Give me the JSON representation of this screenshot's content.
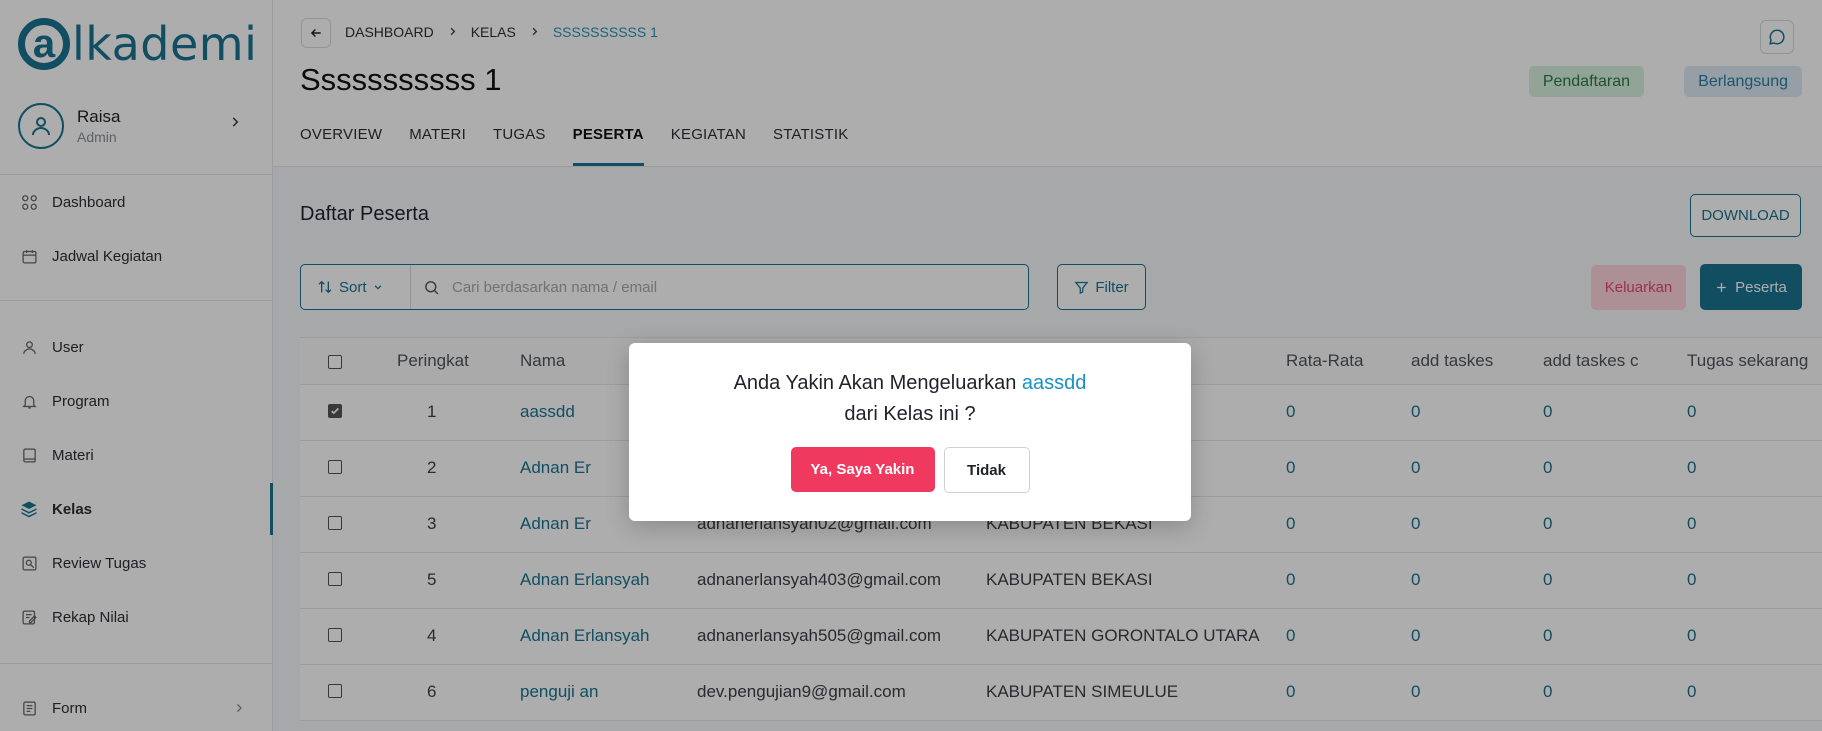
{
  "app": {
    "logo_text": "lkademi",
    "logo_mark": "a"
  },
  "profile": {
    "name": "Raisa",
    "role": "Admin"
  },
  "sidebar": {
    "items": [
      {
        "label": "Dashboard",
        "icon": "grid-icon"
      },
      {
        "label": "Jadwal Kegiatan",
        "icon": "calendar-icon"
      },
      {
        "label": "User",
        "icon": "user-icon"
      },
      {
        "label": "Program",
        "icon": "bell-icon"
      },
      {
        "label": "Materi",
        "icon": "book-icon"
      },
      {
        "label": "Kelas",
        "icon": "layers-icon"
      },
      {
        "label": "Review Tugas",
        "icon": "review-icon"
      },
      {
        "label": "Rekap Nilai",
        "icon": "edit-icon"
      },
      {
        "label": "Form",
        "icon": "form-icon"
      }
    ]
  },
  "breadcrumb": {
    "items": [
      "DASHBOARD",
      "KELAS",
      "SSSSSSSSSS 1"
    ]
  },
  "page": {
    "title": "Sssssssssss 1"
  },
  "badges": {
    "pendaftaran": "Pendaftaran",
    "berlangsung": "Berlangsung"
  },
  "tabs": [
    "OVERVIEW",
    "MATERI",
    "TUGAS",
    "PESERTA",
    "KEGIATAN",
    "STATISTIK"
  ],
  "main": {
    "section_title": "Daftar Peserta",
    "download_label": "DOWNLOAD",
    "sort_label": "Sort",
    "search_placeholder": "Cari berdasarkan nama / email",
    "filter_label": "Filter",
    "keluarkan_label": "Keluarkan",
    "peserta_label": "Peserta"
  },
  "table": {
    "headers": {
      "rank": "Peringkat",
      "name": "Nama",
      "avg": "Rata-Rata",
      "add1": "add taskes",
      "add2": "add taskes c",
      "current": "Tugas sekarang"
    },
    "rows": [
      {
        "checked": true,
        "rank": "1",
        "name": "aassdd",
        "email": "",
        "region": "",
        "avg": "0",
        "add1": "0",
        "add2": "0",
        "current": "0"
      },
      {
        "checked": false,
        "rank": "2",
        "name": "Adnan Er",
        "email": "",
        "region": "",
        "avg": "0",
        "add1": "0",
        "add2": "0",
        "current": "0"
      },
      {
        "checked": false,
        "rank": "3",
        "name": "Adnan Er",
        "email": "adnanerlansyah02@gmail.com",
        "region": "KABUPATEN BEKASI",
        "avg": "0",
        "add1": "0",
        "add2": "0",
        "current": "0"
      },
      {
        "checked": false,
        "rank": "5",
        "name": "Adnan Erlansyah",
        "email": "adnanerlansyah403@gmail.com",
        "region": "KABUPATEN BEKASI",
        "avg": "0",
        "add1": "0",
        "add2": "0",
        "current": "0"
      },
      {
        "checked": false,
        "rank": "4",
        "name": "Adnan Erlansyah",
        "email": "adnanerlansyah505@gmail.com",
        "region": "KABUPATEN GORONTALO UTARA",
        "avg": "0",
        "add1": "0",
        "add2": "0",
        "current": "0"
      },
      {
        "checked": false,
        "rank": "6",
        "name": "penguji an",
        "email": "dev.pengujian9@gmail.com",
        "region": "KABUPATEN SIMEULUE",
        "avg": "0",
        "add1": "0",
        "add2": "0",
        "current": "0"
      }
    ]
  },
  "modal": {
    "line1_prefix": "Anda Yakin Akan Mengeluarkan ",
    "target_name": "aassdd",
    "line2": "dari Kelas ini ?",
    "confirm_label": "Ya, Saya Yakin",
    "cancel_label": "Tidak"
  },
  "colors": {
    "brand": "#1a7391",
    "danger": "#f0395f",
    "link": "#1a92be"
  }
}
